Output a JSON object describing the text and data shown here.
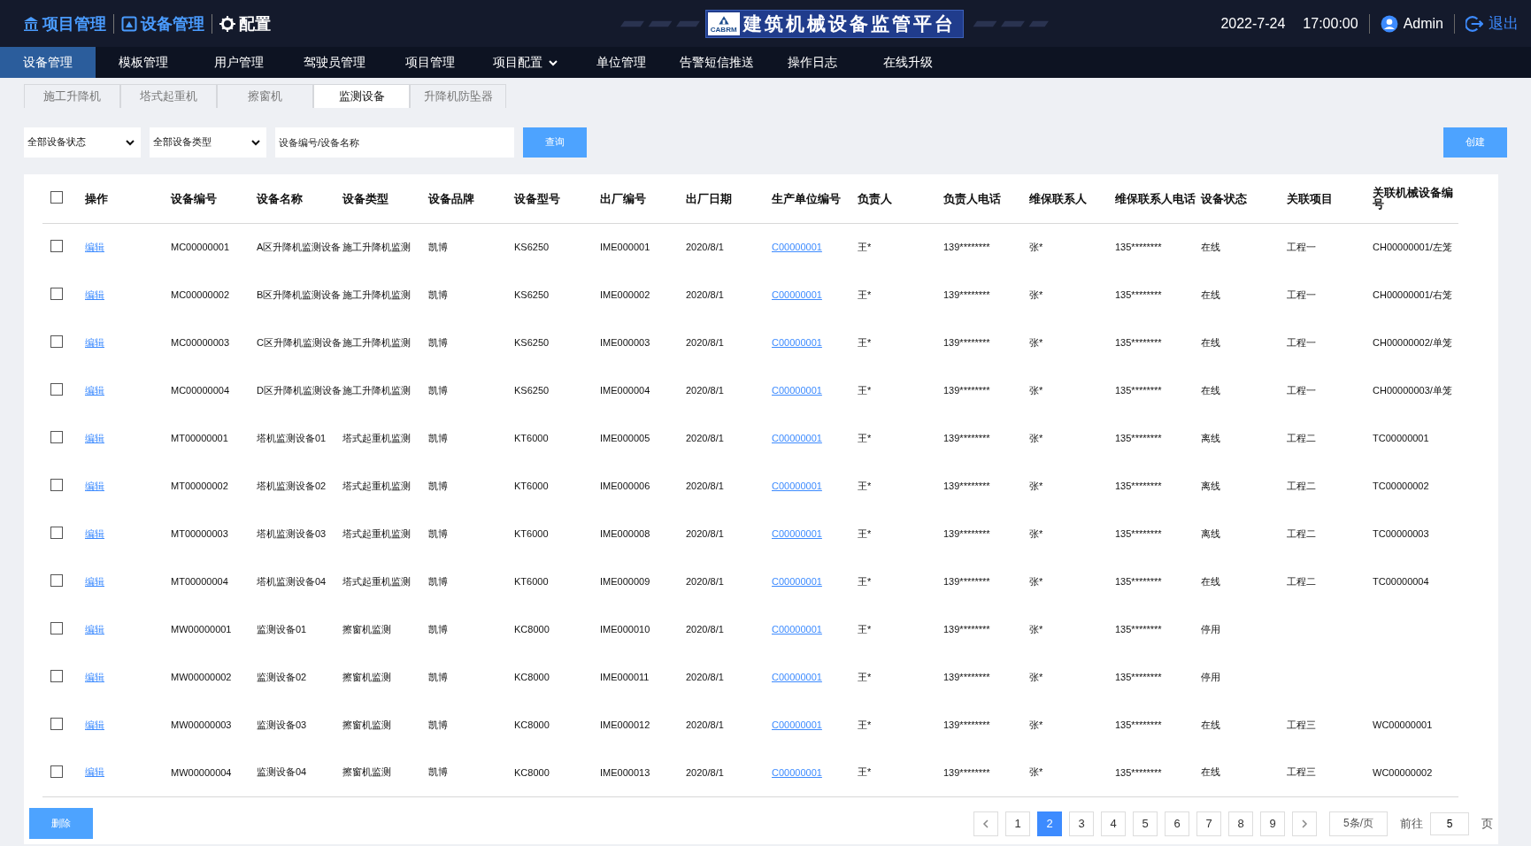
{
  "header": {
    "links": [
      {
        "label": "项目管理",
        "kind": "bank"
      },
      {
        "label": "设备管理",
        "kind": "monitor"
      },
      {
        "label": "配置",
        "kind": "gear"
      }
    ],
    "title": "建筑机械设备监管平台",
    "logo_caption": "CABRM",
    "date": "2022-7-24",
    "time": "17:00:00",
    "user": "Admin",
    "logout": "退出"
  },
  "nav": [
    {
      "label": "设备管理",
      "selected": true
    },
    {
      "label": "模板管理",
      "selected": false
    },
    {
      "label": "用户管理",
      "selected": false
    },
    {
      "label": "驾驶员管理",
      "selected": false
    },
    {
      "label": "项目管理",
      "selected": false
    },
    {
      "label": "项目配置",
      "selected": false,
      "dropdown": true
    },
    {
      "label": "单位管理",
      "selected": false
    },
    {
      "label": "告警短信推送",
      "selected": false
    },
    {
      "label": "操作日志",
      "selected": false
    },
    {
      "label": "在线升级",
      "selected": false
    }
  ],
  "subtabs": [
    {
      "label": "施工升降机",
      "selected": false
    },
    {
      "label": "塔式起重机",
      "selected": false
    },
    {
      "label": "擦窗机",
      "selected": false
    },
    {
      "label": "监测设备",
      "selected": true
    },
    {
      "label": "升降机防坠器",
      "selected": false
    }
  ],
  "filters": {
    "status": "全部设备状态",
    "type": "全部设备类型",
    "search_placeholder": "设备编号/设备名称",
    "query": "查询",
    "create": "创建"
  },
  "table": {
    "all_checked": false,
    "columns": [
      {
        "label": "操作",
        "kind": "edit"
      },
      {
        "label": "设备编号",
        "kind": "text"
      },
      {
        "label": "设备名称",
        "kind": "text"
      },
      {
        "label": "设备类型",
        "kind": "text"
      },
      {
        "label": "设备品牌",
        "kind": "text"
      },
      {
        "label": "设备型号",
        "kind": "text"
      },
      {
        "label": "出厂编号",
        "kind": "text"
      },
      {
        "label": "出厂日期",
        "kind": "text"
      },
      {
        "label": "生产单位编号",
        "kind": "link"
      },
      {
        "label": "负责人",
        "kind": "text"
      },
      {
        "label": "负责人电话",
        "kind": "text"
      },
      {
        "label": "维保联系人",
        "kind": "text"
      },
      {
        "label": "维保联系人电话",
        "kind": "text"
      },
      {
        "label": "设备状态",
        "kind": "text"
      },
      {
        "label": "关联项目",
        "kind": "text"
      },
      {
        "label": "关联机械设备编号",
        "kind": "text"
      }
    ],
    "rows": [
      {
        "checked": false,
        "cells": [
          "编辑",
          "MC00000001",
          "A区升降机监测设备",
          "施工升降机监测",
          "凯博",
          "KS6250",
          "IME000001",
          "2020/8/1",
          "C00000001",
          "王*",
          "139********",
          "张*",
          "135********",
          "在线",
          "工程一",
          "CH00000001/左笼"
        ]
      },
      {
        "checked": false,
        "cells": [
          "编辑",
          "MC00000002",
          "B区升降机监测设备",
          "施工升降机监测",
          "凯博",
          "KS6250",
          "IME000002",
          "2020/8/1",
          "C00000001",
          "王*",
          "139********",
          "张*",
          "135********",
          "在线",
          "工程一",
          "CH00000001/右笼"
        ]
      },
      {
        "checked": false,
        "cells": [
          "编辑",
          "MC00000003",
          "C区升降机监测设备",
          "施工升降机监测",
          "凯博",
          "KS6250",
          "IME000003",
          "2020/8/1",
          "C00000001",
          "王*",
          "139********",
          "张*",
          "135********",
          "在线",
          "工程一",
          "CH00000002/单笼"
        ]
      },
      {
        "checked": false,
        "cells": [
          "编辑",
          "MC00000004",
          "D区升降机监测设备",
          "施工升降机监测",
          "凯博",
          "KS6250",
          "IME000004",
          "2020/8/1",
          "C00000001",
          "王*",
          "139********",
          "张*",
          "135********",
          "在线",
          "工程一",
          "CH00000003/单笼"
        ]
      },
      {
        "checked": false,
        "cells": [
          "编辑",
          "MT00000001",
          "塔机监测设备01",
          "塔式起重机监测",
          "凯博",
          "KT6000",
          "IME000005",
          "2020/8/1",
          "C00000001",
          "王*",
          "139********",
          "张*",
          "135********",
          "离线",
          "工程二",
          "TC00000001"
        ]
      },
      {
        "checked": false,
        "cells": [
          "编辑",
          "MT00000002",
          "塔机监测设备02",
          "塔式起重机监测",
          "凯博",
          "KT6000",
          "IME000006",
          "2020/8/1",
          "C00000001",
          "王*",
          "139********",
          "张*",
          "135********",
          "离线",
          "工程二",
          "TC00000002"
        ]
      },
      {
        "checked": false,
        "cells": [
          "编辑",
          "MT00000003",
          "塔机监测设备03",
          "塔式起重机监测",
          "凯博",
          "KT6000",
          "IME000008",
          "2020/8/1",
          "C00000001",
          "王*",
          "139********",
          "张*",
          "135********",
          "离线",
          "工程二",
          "TC00000003"
        ]
      },
      {
        "checked": false,
        "cells": [
          "编辑",
          "MT00000004",
          "塔机监测设备04",
          "塔式起重机监测",
          "凯博",
          "KT6000",
          "IME000009",
          "2020/8/1",
          "C00000001",
          "王*",
          "139********",
          "张*",
          "135********",
          "在线",
          "工程二",
          "TC00000004"
        ]
      },
      {
        "checked": false,
        "cells": [
          "编辑",
          "MW00000001",
          "监测设备01",
          "擦窗机监测",
          "凯博",
          "KC8000",
          "IME000010",
          "2020/8/1",
          "C00000001",
          "王*",
          "139********",
          "张*",
          "135********",
          "停用",
          "",
          ""
        ]
      },
      {
        "checked": false,
        "cells": [
          "编辑",
          "MW00000002",
          "监测设备02",
          "擦窗机监测",
          "凯博",
          "KC8000",
          "IME000011",
          "2020/8/1",
          "C00000001",
          "王*",
          "139********",
          "张*",
          "135********",
          "停用",
          "",
          ""
        ]
      },
      {
        "checked": false,
        "cells": [
          "编辑",
          "MW00000003",
          "监测设备03",
          "擦窗机监测",
          "凯博",
          "KC8000",
          "IME000012",
          "2020/8/1",
          "C00000001",
          "王*",
          "139********",
          "张*",
          "135********",
          "在线",
          "工程三",
          "WC00000001"
        ]
      },
      {
        "checked": false,
        "cells": [
          "编辑",
          "MW00000004",
          "监测设备04",
          "擦窗机监测",
          "凯博",
          "KC8000",
          "IME000013",
          "2020/8/1",
          "C00000001",
          "王*",
          "139********",
          "张*",
          "135********",
          "在线",
          "工程三",
          "WC00000002"
        ]
      }
    ]
  },
  "footer": {
    "delete": "删除",
    "pages": [
      {
        "label": "1",
        "selected": false
      },
      {
        "label": "2",
        "selected": true
      },
      {
        "label": "3",
        "selected": false
      },
      {
        "label": "4",
        "selected": false
      },
      {
        "label": "5",
        "selected": false
      },
      {
        "label": "6",
        "selected": false
      },
      {
        "label": "7",
        "selected": false
      },
      {
        "label": "8",
        "selected": false
      },
      {
        "label": "9",
        "selected": false
      }
    ],
    "page_size": "5条/页",
    "goto": "前往",
    "goto_value": "5",
    "page_unit": "页"
  }
}
